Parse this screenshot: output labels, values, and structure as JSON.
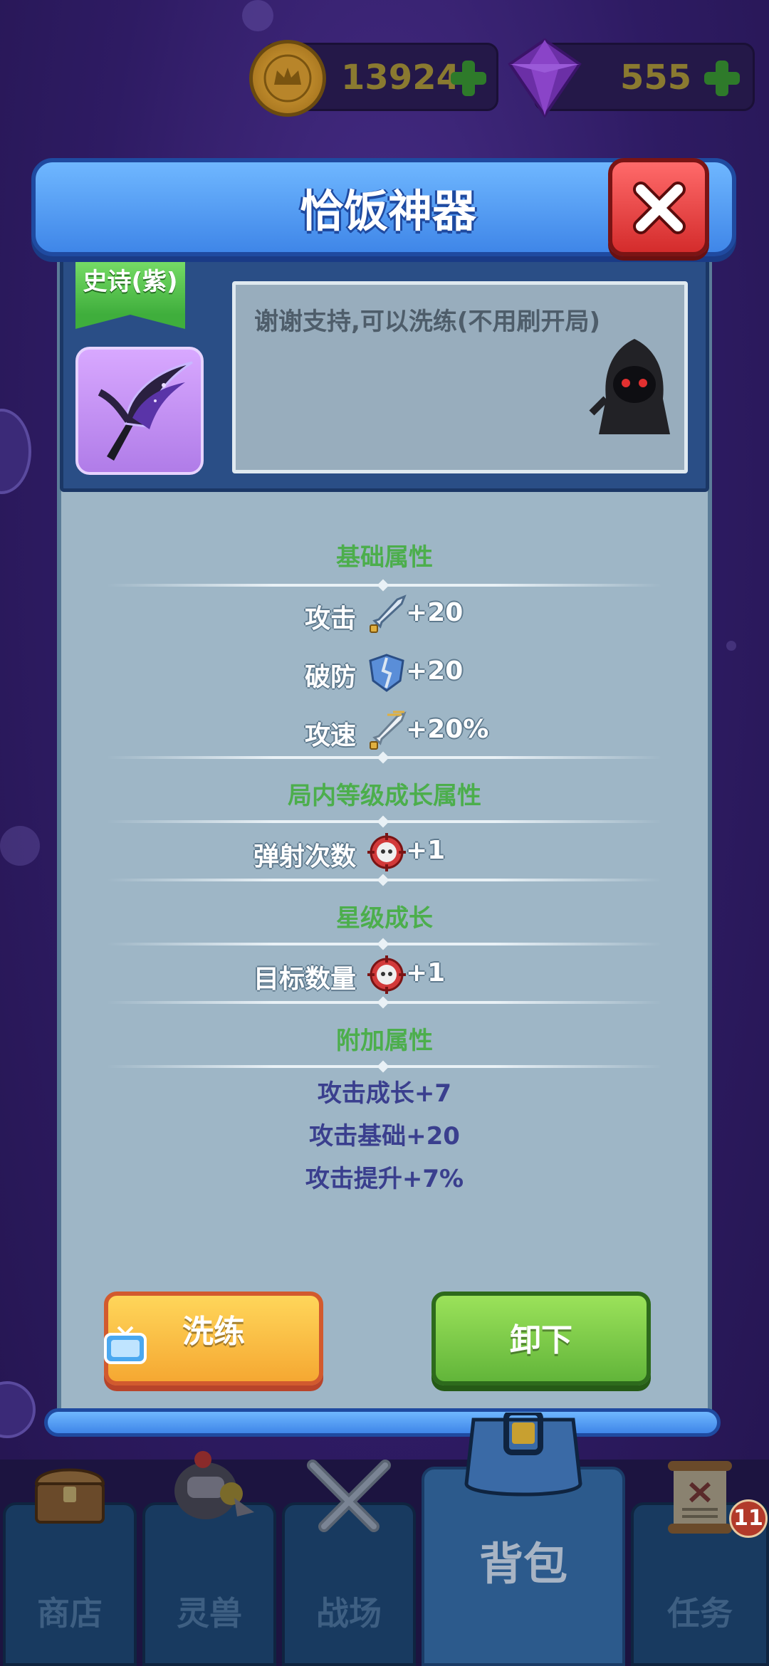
{
  "currency": {
    "gold": {
      "value": "13924",
      "icon": "crown-coin-icon"
    },
    "gem": {
      "value": "555",
      "icon": "purple-gem-icon"
    }
  },
  "dialog": {
    "title": "恰饭神器",
    "close_icon": "close-icon",
    "rarity": "史诗(紫)",
    "item_icon": "purple-scythe-icon",
    "description": "谢谢支持,可以洗练(不用刷开局)"
  },
  "sections": {
    "base": {
      "title": "基础属性",
      "attrs": [
        {
          "name": "攻击",
          "icon": "sword-icon",
          "value": "+20"
        },
        {
          "name": "破防",
          "icon": "broken-shield-icon",
          "value": "+20"
        },
        {
          "name": "攻速",
          "icon": "swift-sword-icon",
          "value": "+20%"
        }
      ]
    },
    "growth": {
      "title": "局内等级成长属性",
      "attrs": [
        {
          "name": "弹射次数",
          "icon": "target-skull-icon",
          "value": "+1"
        }
      ]
    },
    "star": {
      "title": "星级成长",
      "attrs": [
        {
          "name": "目标数量",
          "icon": "target-skull-icon",
          "value": "+1"
        }
      ]
    },
    "extra": {
      "title": "附加属性",
      "lines": [
        "攻击成长+7",
        "攻击基础+20",
        "攻击提升+7%"
      ]
    }
  },
  "buttons": {
    "reroll": "洗练",
    "unequip": "卸下"
  },
  "nav": {
    "tabs": [
      {
        "label": "商店",
        "icon": "treasure-chest-icon"
      },
      {
        "label": "灵兽",
        "icon": "knight-pet-icon"
      },
      {
        "label": "战场",
        "icon": "crossed-swords-icon"
      },
      {
        "label": "背包",
        "icon": "backpack-icon"
      },
      {
        "label": "任务",
        "icon": "scroll-icon"
      }
    ],
    "active": "背包",
    "task_badge": "11"
  },
  "colors": {
    "section_title": "#4cae4c",
    "extra_attr": "#3a3f8e",
    "header_blue": "#4a90e8",
    "close_red": "#d42c2c"
  }
}
